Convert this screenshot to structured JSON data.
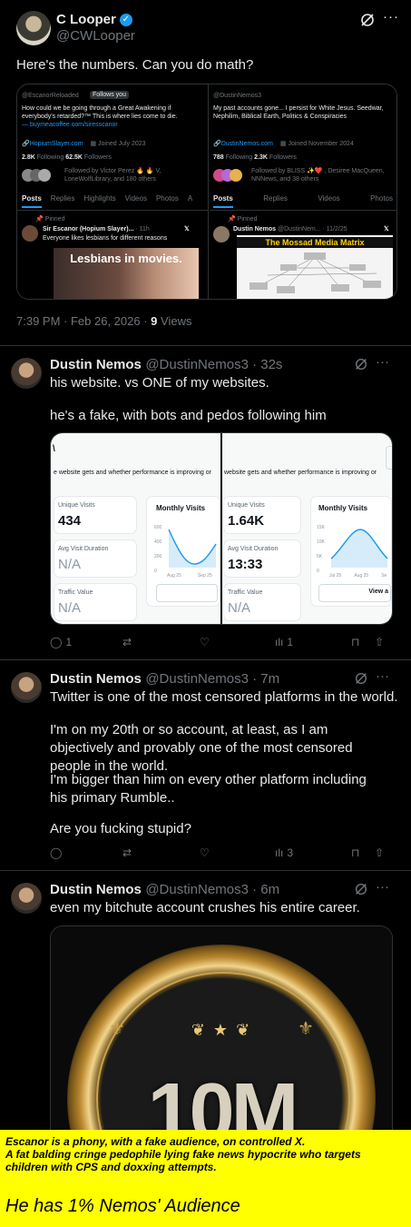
{
  "top_post": {
    "name": "C Looper",
    "handle": "@CWLooper",
    "text": "Here's the numbers. Can you do math?",
    "timestamp": "7:39 PM · Feb 26, 2026 ·",
    "views_count": "9",
    "views_label": "Views",
    "left_panel": {
      "handle": "@EscanorReloaded",
      "follows_you": "Follows you",
      "bio": "How could we be going through a Great Awakening if everybody's retarded?™ This is where lies come to die.",
      "link_in_bio": "— buymeacoffee.com/siresscanor",
      "website": "HopiumSlayer.com",
      "joined": "Joined July 2023",
      "following_count": "2.8K",
      "following_label": "Following",
      "followers_count": "62.5K",
      "followers_label": "Followers",
      "followed_by": "Followed by Victor Perez 🔥 🔥 V, LoneWolfLibrary, and 180 others",
      "tabs": [
        "Posts",
        "Replies",
        "Highlights",
        "Videos",
        "Photos",
        "A"
      ],
      "pinned_label": "Pinned",
      "pinned_name": "Sir Escanor (Hopium Slayer)...",
      "pinned_time": "· 11h",
      "pinned_text": "Everyone likes lesbians for different reasons",
      "media_caption": "Lesbians in movies."
    },
    "right_panel": {
      "handle": "@DustinNemos3",
      "bio": "My past accounts gone... I persist for White Jesus. Seedwar, Nephilim, Biblical Earth, Politics & Conspiracies",
      "website": "DustinNemos.com",
      "joined": "Joined November 2024",
      "following_count": "788",
      "following_label": "Following",
      "followers_count": "2.3K",
      "followers_label": "Followers",
      "followed_by": "Followed by BLISS ✨❤️ , Desiree MacQueen, NNNews, and 38 others",
      "tabs": [
        "Posts",
        "Replies",
        "Videos",
        "Photos"
      ],
      "pinned_label": "Pinned",
      "pinned_name": "Dustin Nemos",
      "pinned_handle": "@DustinNem... · 11/2/25",
      "media_title": "The Mossad Media Matrix"
    }
  },
  "reply1": {
    "name": "Dustin Nemos",
    "handle": "@DustinNemos3 · 32s",
    "text1": "his website. vs ONE of my websites.",
    "text2": "he's a fake, with bots and pedos following him",
    "replies": "1",
    "retweets": "",
    "likes": "",
    "views": "1",
    "image": {
      "left": {
        "subtitle": "e website gets and whether performance is improving or",
        "unique_label": "Unique Visits",
        "unique_value": "434",
        "duration_label": "Avg Visit Duration",
        "duration_value": "N/A",
        "traffic_label": "Traffic Value",
        "traffic_value": "N/A",
        "monthly_label": "Monthly Visits",
        "y_ticks": [
          "600",
          "400",
          "200",
          "0"
        ],
        "x_ticks": [
          "Aug 25",
          "Sep 25"
        ]
      },
      "right": {
        "subtitle": "website gets and whether performance is improving or",
        "unique_label": "Unique Visits",
        "unique_value": "1.64K",
        "duration_label": "Avg Visit Duration",
        "duration_value": "13:33",
        "traffic_label": "Traffic Value",
        "traffic_value": "N/A",
        "monthly_label": "Monthly Visits",
        "y_ticks": [
          "15K",
          "10K",
          "5K",
          "0"
        ],
        "x_ticks": [
          "Jul 25",
          "Aug 25",
          "Se"
        ],
        "view_label": "View a"
      }
    }
  },
  "reply2": {
    "name": "Dustin Nemos",
    "handle": "@DustinNemos3 · 7m",
    "p1": "Twitter is one of the most censored platforms in the world.",
    "p2": "I'm on my 20th or so account, at least, as I am objectively and provably one of the most censored people in the world.",
    "p3": "I'm bigger than him on every other platform including his primary Rumble..",
    "p4": "Are you fucking stupid?",
    "views": "3"
  },
  "reply3": {
    "name": "Dustin Nemos",
    "handle": "@DustinNemos3 · 6m",
    "text": "even my bitchute account crushes his entire career.",
    "badge": "10M"
  },
  "banner": {
    "line1": "Escanor is a phony, with a fake audience, on controlled X.",
    "line2": "A fat balding cringe pedophile lying fake news hypocrite who targets children with CPS and doxxing attempts.",
    "headline": "He has 1% Nemos' Audience"
  },
  "colors": {
    "background": "#000000",
    "text": "#e7e9ea",
    "muted": "#71767b",
    "accent": "#1d9bf0",
    "banner": "#ffff00",
    "chart": "#1d9bf0"
  }
}
